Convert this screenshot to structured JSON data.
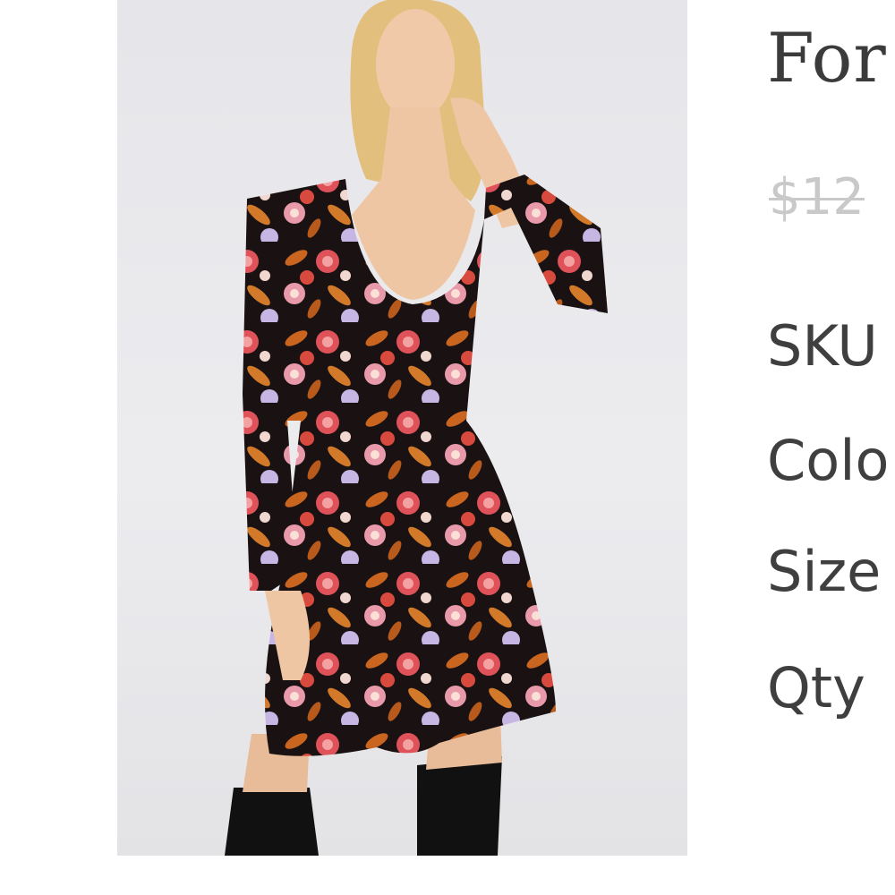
{
  "product": {
    "title": "For",
    "old_price": "$12",
    "attributes": [
      {
        "label": "SKU"
      },
      {
        "label": "Colo"
      },
      {
        "label": "Size"
      },
      {
        "label": "Qty"
      }
    ]
  },
  "colors": {
    "text": "#3b3b3b",
    "strike_price": "#c9c9c9",
    "photo_background": "#e8e8eb"
  }
}
